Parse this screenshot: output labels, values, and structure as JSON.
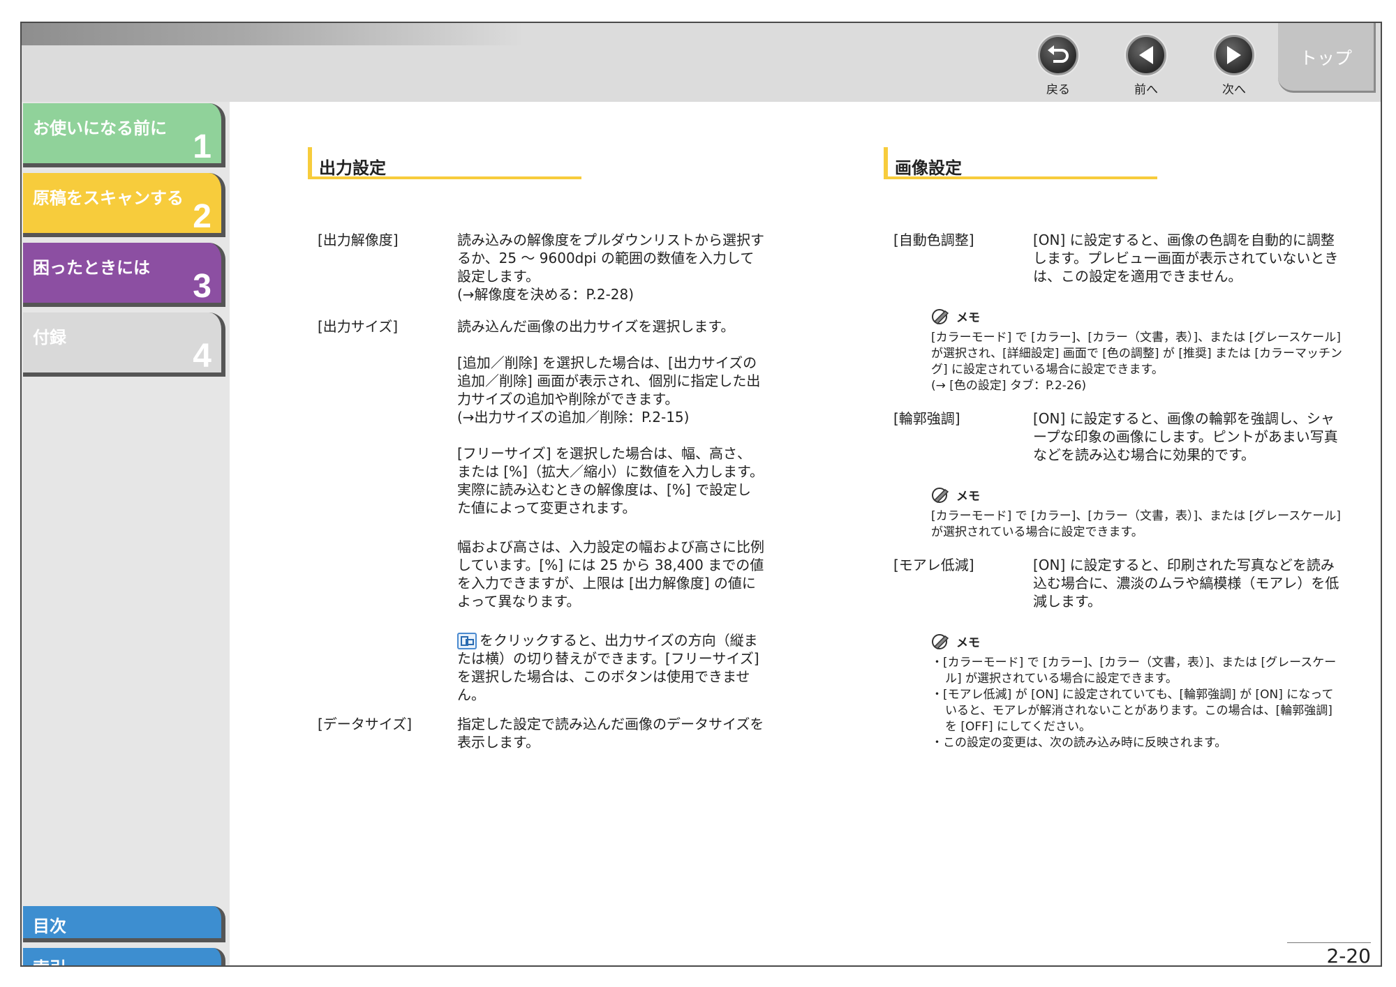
{
  "nav": {
    "back": "戻る",
    "prev": "前へ",
    "next": "次へ",
    "top": "トップ"
  },
  "sidebar": {
    "chapters": [
      {
        "title": "お使いになる前に",
        "num": "1"
      },
      {
        "title": "原稿をスキャンする",
        "num": "2"
      },
      {
        "title": "困ったときには",
        "num": "3"
      },
      {
        "title": "付録",
        "num": "4"
      }
    ],
    "toc": "目次",
    "index": "索引"
  },
  "left": {
    "title": "出力設定",
    "items": [
      {
        "term": "[出力解像度]",
        "desc": "読み込みの解像度をプルダウンリストから選択するか、25 〜 9600dpi の範囲の数値を入力して設定します。\n(→解像度を決める：P.2-28)"
      },
      {
        "term": "[出力サイズ]",
        "desc": "読み込んだ画像の出力サイズを選択します。"
      },
      {
        "term": "",
        "desc": "[追加／削除] を選択した場合は、[出力サイズの追加／削除] 画面が表示され、個別に指定した出力サイズの追加や削除ができます。\n(→出力サイズの追加／削除：P.2-15)"
      },
      {
        "term": "",
        "desc": "[フリーサイズ] を選択した場合は、幅、高さ、または [%]（拡大／縮小）に数値を入力します。実際に読み込むときの解像度は、[%] で設定した値によって変更されます。"
      },
      {
        "term": "",
        "desc": "幅および高さは、入力設定の幅および高さに比例しています。[%] には 25 から 38,400 までの値を入力できますが、上限は [出力解像度] の値によって異なります。"
      },
      {
        "term": "",
        "desc": "をクリックすると、出力サイズの方向（縦または横）の切り替えができます。[フリーサイズ] を選択した場合は、このボタンは使用できません。"
      },
      {
        "term": "[データサイズ]",
        "desc": "指定した設定で読み込んだ画像のデータサイズを表示します。"
      }
    ]
  },
  "right": {
    "title": "画像設定",
    "items": [
      {
        "term": "[自動色調整]",
        "desc": "[ON] に設定すると、画像の色調を自動的に調整します。プレビュー画面が表示されていないときは、この設定を適用できません。"
      },
      {
        "term": "[輪郭強調]",
        "desc": "[ON] に設定すると、画像の輪郭を強調し、シャープな印象の画像にします。ピントがあまい写真などを読み込む場合に効果的です。"
      },
      {
        "term": "[モアレ低減]",
        "desc": "[ON] に設定すると、印刷された写真などを読み込む場合に、濃淡のムラや縞模様（モアレ）を低減します。"
      }
    ],
    "memo_label": "メモ",
    "memo1": "[カラーモード] で [カラー]、[カラー（文書，表）]、または [グレースケール] が選択され、[詳細設定] 画面で [色の調整] が [推奨] または [カラーマッチング] に設定されている場合に設定できます。\n(→ [色の設定] タブ：P.2-26)",
    "memo2": "[カラーモード] で [カラー]、[カラー（文書，表）]、または [グレースケール] が選択されている場合に設定できます。",
    "memo3": [
      "・[カラーモード] で [カラー]、[カラー（文書，表）]、または [グレースケール] が選択されている場合に設定できます。",
      "・[モアレ低減] が [ON] に設定されていても、[輪郭強調] が [ON] になっていると、モアレが解消されないことがあります。この場合は、[輪郭強調] を [OFF] にしてください。",
      "・この設定の変更は、次の読み込み時に反映されます。"
    ]
  },
  "page_number": "2-20"
}
